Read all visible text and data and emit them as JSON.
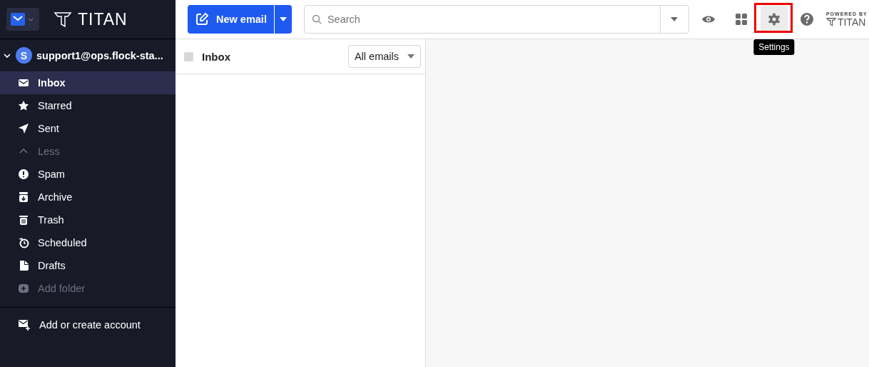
{
  "brand": {
    "name": "TITAN"
  },
  "toolbar": {
    "new_email": "New email",
    "search": {
      "placeholder": "Search"
    },
    "tooltip": "Settings",
    "settings_selected": true,
    "powered_by": "POWERED BY",
    "powered_brand": "TITAN"
  },
  "account": {
    "initial": "S",
    "email": "support1@ops.flock-sta...",
    "expanded": true
  },
  "sidebar": {
    "items": [
      {
        "label": "Inbox",
        "kind": "folder",
        "selected": true
      },
      {
        "label": "Starred",
        "kind": "folder",
        "selected": false
      },
      {
        "label": "Sent",
        "kind": "folder",
        "selected": false
      },
      {
        "label": "Less",
        "kind": "toggle",
        "selected": false
      },
      {
        "label": "Spam",
        "kind": "folder",
        "selected": false
      },
      {
        "label": "Archive",
        "kind": "folder",
        "selected": false
      },
      {
        "label": "Trash",
        "kind": "folder",
        "selected": false
      },
      {
        "label": "Scheduled",
        "kind": "folder",
        "selected": false
      },
      {
        "label": "Drafts",
        "kind": "folder",
        "selected": false
      },
      {
        "label": "Add folder",
        "kind": "add",
        "selected": false
      }
    ],
    "add_account": "Add or create account"
  },
  "list": {
    "title": "Inbox",
    "select_all_checked": false,
    "filter": "All emails"
  }
}
